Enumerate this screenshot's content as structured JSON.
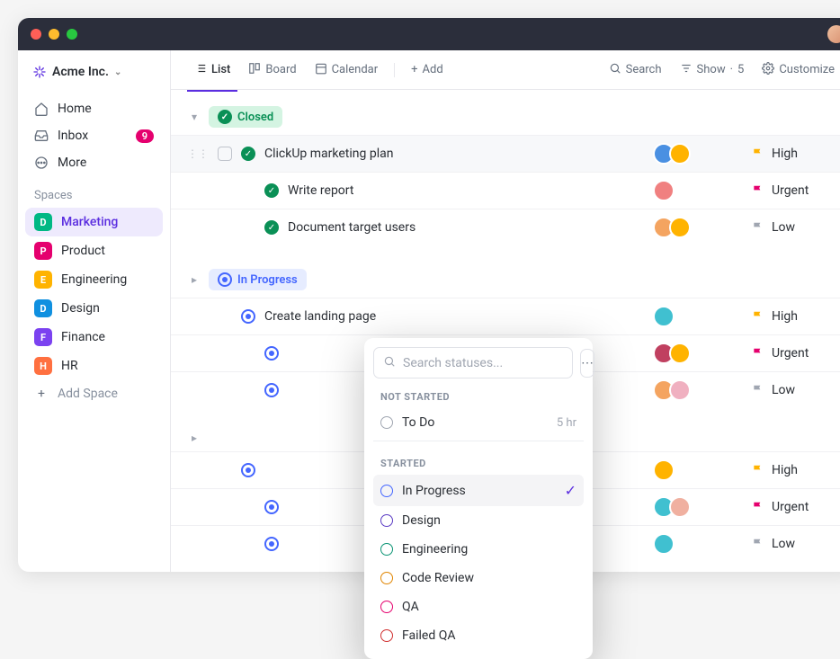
{
  "workspace": {
    "name": "Acme Inc."
  },
  "nav": {
    "home": "Home",
    "inbox": "Inbox",
    "inbox_badge": "9",
    "more": "More"
  },
  "spaces_label": "Spaces",
  "spaces": [
    {
      "letter": "D",
      "name": "Marketing",
      "color": "#00b884",
      "active": true
    },
    {
      "letter": "P",
      "name": "Product",
      "color": "#e5006e"
    },
    {
      "letter": "E",
      "name": "Engineering",
      "color": "#ffb300"
    },
    {
      "letter": "D",
      "name": "Design",
      "color": "#1090e0"
    },
    {
      "letter": "F",
      "name": "Finance",
      "color": "#7b42f0"
    },
    {
      "letter": "H",
      "name": "HR",
      "color": "#ff7040"
    }
  ],
  "add_space": "Add Space",
  "toolbar": {
    "list": "List",
    "board": "Board",
    "calendar": "Calendar",
    "add": "Add",
    "search": "Search",
    "show": "Show",
    "show_count": "5",
    "customize": "Customize"
  },
  "groups": {
    "closed": {
      "label": "Closed"
    },
    "in_progress": {
      "label": "In Progress"
    }
  },
  "tasks_closed": [
    {
      "title": "ClickUp marketing plan",
      "priority": "High",
      "flag": "#ffb300",
      "av": [
        "#4a90e2",
        "#ffb300"
      ],
      "hover": true,
      "indent": 0
    },
    {
      "title": "Write report",
      "priority": "Urgent",
      "flag": "#e5006e",
      "av": [
        "#f08080"
      ],
      "indent": 1
    },
    {
      "title": "Document target users",
      "priority": "Low",
      "flag": "#a0a6b1",
      "av": [
        "#f4a460",
        "#ffb300"
      ],
      "indent": 1
    }
  ],
  "tasks_progress": [
    {
      "title": "Create landing page",
      "priority": "High",
      "flag": "#ffb300",
      "av": [
        "#40c0d0"
      ],
      "indent": 0
    },
    {
      "title": "",
      "priority": "Urgent",
      "flag": "#e5006e",
      "av": [
        "#c04060",
        "#ffb300"
      ],
      "indent": 1
    },
    {
      "title": "",
      "priority": "Low",
      "flag": "#a0a6b1",
      "av": [
        "#f4a460",
        "#f0b0c0"
      ],
      "indent": 1
    }
  ],
  "tasks_third": [
    {
      "title": "",
      "priority": "High",
      "flag": "#ffb300",
      "av": [
        "#ffb300"
      ],
      "indent": 0
    },
    {
      "title": "",
      "priority": "Urgent",
      "flag": "#e5006e",
      "av": [
        "#40c0d0",
        "#f0b0a0"
      ],
      "indent": 1
    },
    {
      "title": "",
      "priority": "Low",
      "flag": "#a0a6b1",
      "av": [
        "#40c0d0"
      ],
      "indent": 1
    }
  ],
  "dropdown": {
    "placeholder": "Search statuses...",
    "section_not_started": "NOT STARTED",
    "section_started": "STARTED",
    "items_not_started": [
      {
        "label": "To Do",
        "color": "#a0a6b1",
        "meta": "5 hr"
      }
    ],
    "items_started": [
      {
        "label": "In Progress",
        "color": "#4466ff",
        "selected": true
      },
      {
        "label": "Design",
        "color": "#5b3cc4"
      },
      {
        "label": "Engineering",
        "color": "#0a9474"
      },
      {
        "label": "Code Review",
        "color": "#e08500"
      },
      {
        "label": "QA",
        "color": "#e5006e"
      },
      {
        "label": "Failed QA",
        "color": "#d03030"
      }
    ]
  }
}
